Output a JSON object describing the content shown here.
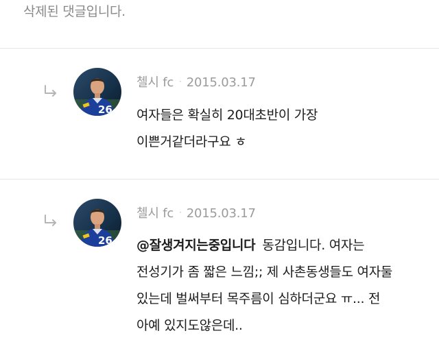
{
  "deleted_notice": "삭제된 댓글입니다.",
  "replies": [
    {
      "author": "첼시 fc",
      "separator": "·",
      "date": "2015.03.17",
      "lines": [
        "여자들은 확실히 20대초반이 가장",
        "이쁜거같더라구요 ㅎ"
      ],
      "avatar_icon": "soccer-player-avatar"
    },
    {
      "author": "첼시 fc",
      "separator": "·",
      "date": "2015.03.17",
      "mention": "@잘생겨지는중입니다",
      "lines": [
        "동감입니다. 여자는",
        "전성기가 좀 짧은 느낌;; 제 사촌동생들도 여자둘",
        "있는데 벌써부터 목주름이 심하더군요 ㅠ... 전",
        "아예 있지도않은데.."
      ],
      "avatar_icon": "soccer-player-avatar"
    }
  ],
  "colors": {
    "meta_text": "#9b9b9b",
    "divider": "#e6e6e6",
    "deleted_text": "#8a8a8a",
    "avatar_kit": "#1d3f9c"
  }
}
